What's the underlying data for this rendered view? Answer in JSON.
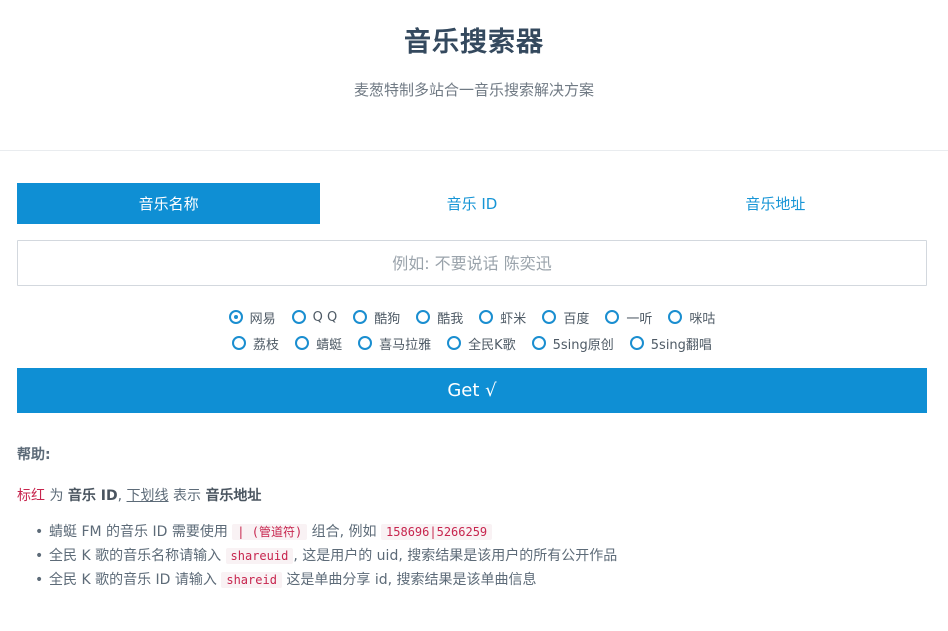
{
  "header": {
    "title": "音乐搜索器",
    "subtitle": "麦葱特制多站合一音乐搜索解决方案"
  },
  "tabs": [
    {
      "label": "音乐名称",
      "active": true
    },
    {
      "label": "音乐 ID",
      "active": false
    },
    {
      "label": "音乐地址",
      "active": false
    }
  ],
  "search": {
    "placeholder": "例如: 不要说话 陈奕迅",
    "value": ""
  },
  "sources": {
    "row1": [
      "网易",
      "Q Q",
      "酷狗",
      "酷我",
      "虾米",
      "百度",
      "一听",
      "咪咕"
    ],
    "row2": [
      "荔枝",
      "蜻蜓",
      "喜马拉雅",
      "全民K歌",
      "5sing原创",
      "5sing翻唱"
    ],
    "selected": "网易"
  },
  "get_button": {
    "label": "Get √"
  },
  "help": {
    "title": "帮助:",
    "legend": {
      "red_text": "标红",
      "is_text": " 为 ",
      "music_id": "音乐 ID",
      "sep": ", ",
      "underline_text": "下划线",
      "means_text": " 表示 ",
      "music_url": "音乐地址"
    },
    "items": [
      {
        "pre": "蜻蜓 FM 的音乐 ID 需要使用 ",
        "code1": "| (管道符)",
        "mid": " 组合, 例如 ",
        "code2": "158696|5266259",
        "post": ""
      },
      {
        "pre": "全民 K 歌的音乐名称请输入 ",
        "code1": "shareuid",
        "mid": ", 这是用户的 uid, 搜索结果是该用户的所有公开作品",
        "code2": "",
        "post": ""
      },
      {
        "pre": "全民 K 歌的音乐 ID 请输入 ",
        "code1": "shareid",
        "mid": " 这是单曲分享 id, 搜索结果是该单曲信息",
        "code2": "",
        "post": ""
      }
    ]
  },
  "colors": {
    "accent": "#0f8fd4",
    "code": "#c7254e",
    "title": "#34495e"
  }
}
